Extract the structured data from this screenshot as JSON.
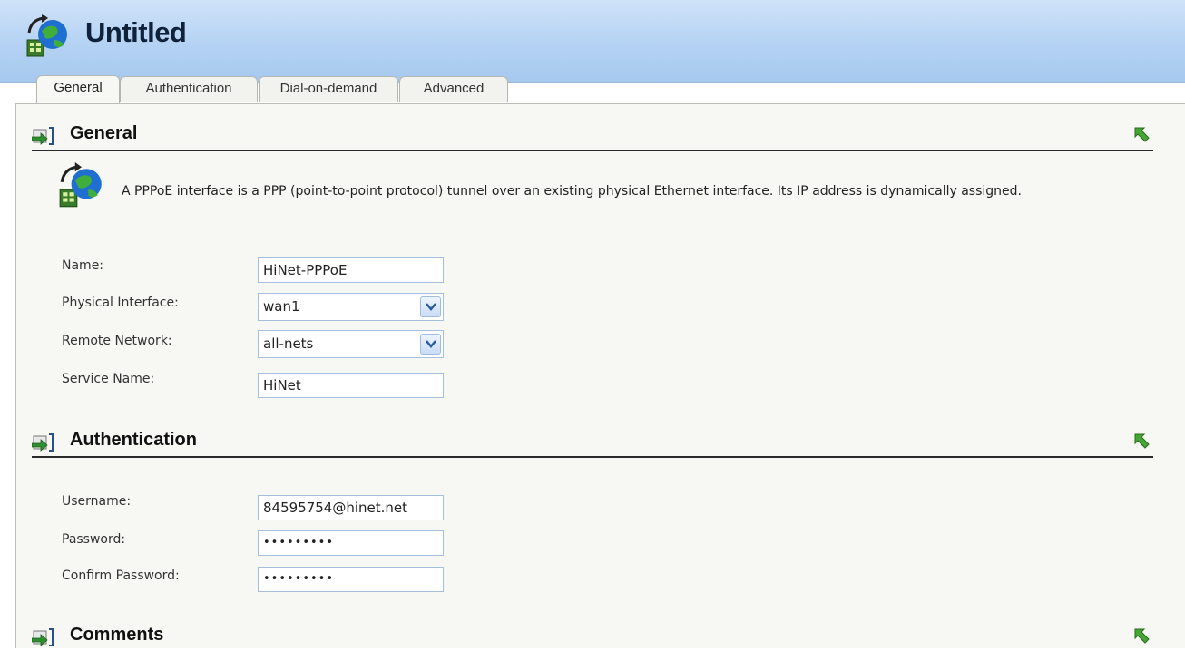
{
  "window": {
    "title": "Untitled"
  },
  "tabs": [
    {
      "label": "General",
      "active": true
    },
    {
      "label": "Authentication",
      "active": false
    },
    {
      "label": "Dial-on-demand",
      "active": false
    },
    {
      "label": "Advanced",
      "active": false
    }
  ],
  "sections": {
    "general": {
      "title": "General",
      "description": "A PPPoE interface is a PPP (point-to-point protocol) tunnel over an existing physical Ethernet interface. Its IP address is dynamically assigned.",
      "fields": {
        "name": {
          "label": "Name:",
          "value": "HiNet-PPPoE"
        },
        "physical_interface": {
          "label": "Physical Interface:",
          "value": "wan1"
        },
        "remote_network": {
          "label": "Remote Network:",
          "value": "all-nets"
        },
        "service_name": {
          "label": "Service Name:",
          "value": "HiNet"
        }
      }
    },
    "authentication": {
      "title": "Authentication",
      "fields": {
        "username": {
          "label": "Username:",
          "value": "84595754@hinet.net"
        },
        "password": {
          "label": "Password:",
          "value": "•••••••••"
        },
        "confirm_password": {
          "label": "Confirm Password:",
          "value": "•••••••••"
        }
      }
    },
    "comments": {
      "title": "Comments"
    }
  },
  "icons": {
    "title": "pppoe-interface-icon",
    "section_arrow": "expand-arrow-icon",
    "collapse": "collapse-up-icon",
    "dropdown": "chevron-down-icon"
  },
  "colors": {
    "titlebar": "#b4d2f3",
    "panel": "#f7f7f3",
    "field_border": "#a5bfde",
    "collapse_green": "#3d9a2a"
  }
}
